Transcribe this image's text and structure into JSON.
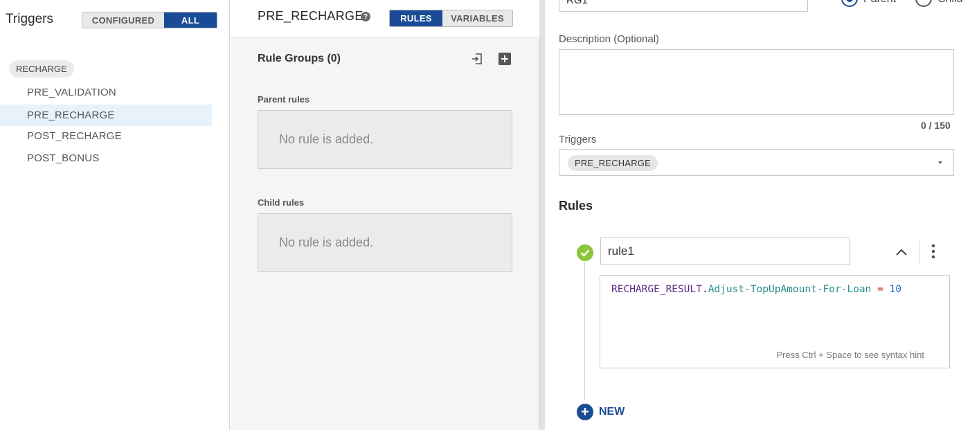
{
  "left": {
    "title": "Triggers",
    "filter": {
      "configured": "CONFIGURED",
      "all": "ALL",
      "active": "all"
    },
    "group": "RECHARGE",
    "items": [
      {
        "label": "PRE_VALIDATION",
        "selected": false
      },
      {
        "label": "PRE_RECHARGE",
        "selected": true
      },
      {
        "label": "POST_RECHARGE",
        "selected": false
      },
      {
        "label": "POST_BONUS",
        "selected": false
      }
    ]
  },
  "middle": {
    "title": "PRE_RECHARGE",
    "help": "?",
    "tabs": {
      "rules": "RULES",
      "variables": "VARIABLES",
      "active": "rules"
    },
    "rule_groups_title": "Rule Groups (0)",
    "parent_label": "Parent rules",
    "parent_empty": "No rule is added.",
    "child_label": "Child rules",
    "child_empty": "No rule is added."
  },
  "right": {
    "name_value": "RG1",
    "radio_parent": "Parent",
    "radio_child": "Child",
    "radio_selected": "parent",
    "description_label": "Description (Optional)",
    "description_value": "",
    "counter": "0 / 150",
    "triggers_label": "Triggers",
    "trigger_chip": "PRE_RECHARGE",
    "rules_title": "Rules",
    "rule": {
      "name": "rule1",
      "code": {
        "object": "RECHARGE_RESULT",
        "dot": ".",
        "property": "Adjust-TopUpAmount-For-Loan",
        "operator": " = ",
        "value": "10"
      },
      "hint": "Press Ctrl + Space to see syntax hint"
    },
    "new_label": "NEW"
  },
  "colors": {
    "primary": "#1a4b96",
    "success": "#8cc43c",
    "selection": "#e8f2fb"
  }
}
